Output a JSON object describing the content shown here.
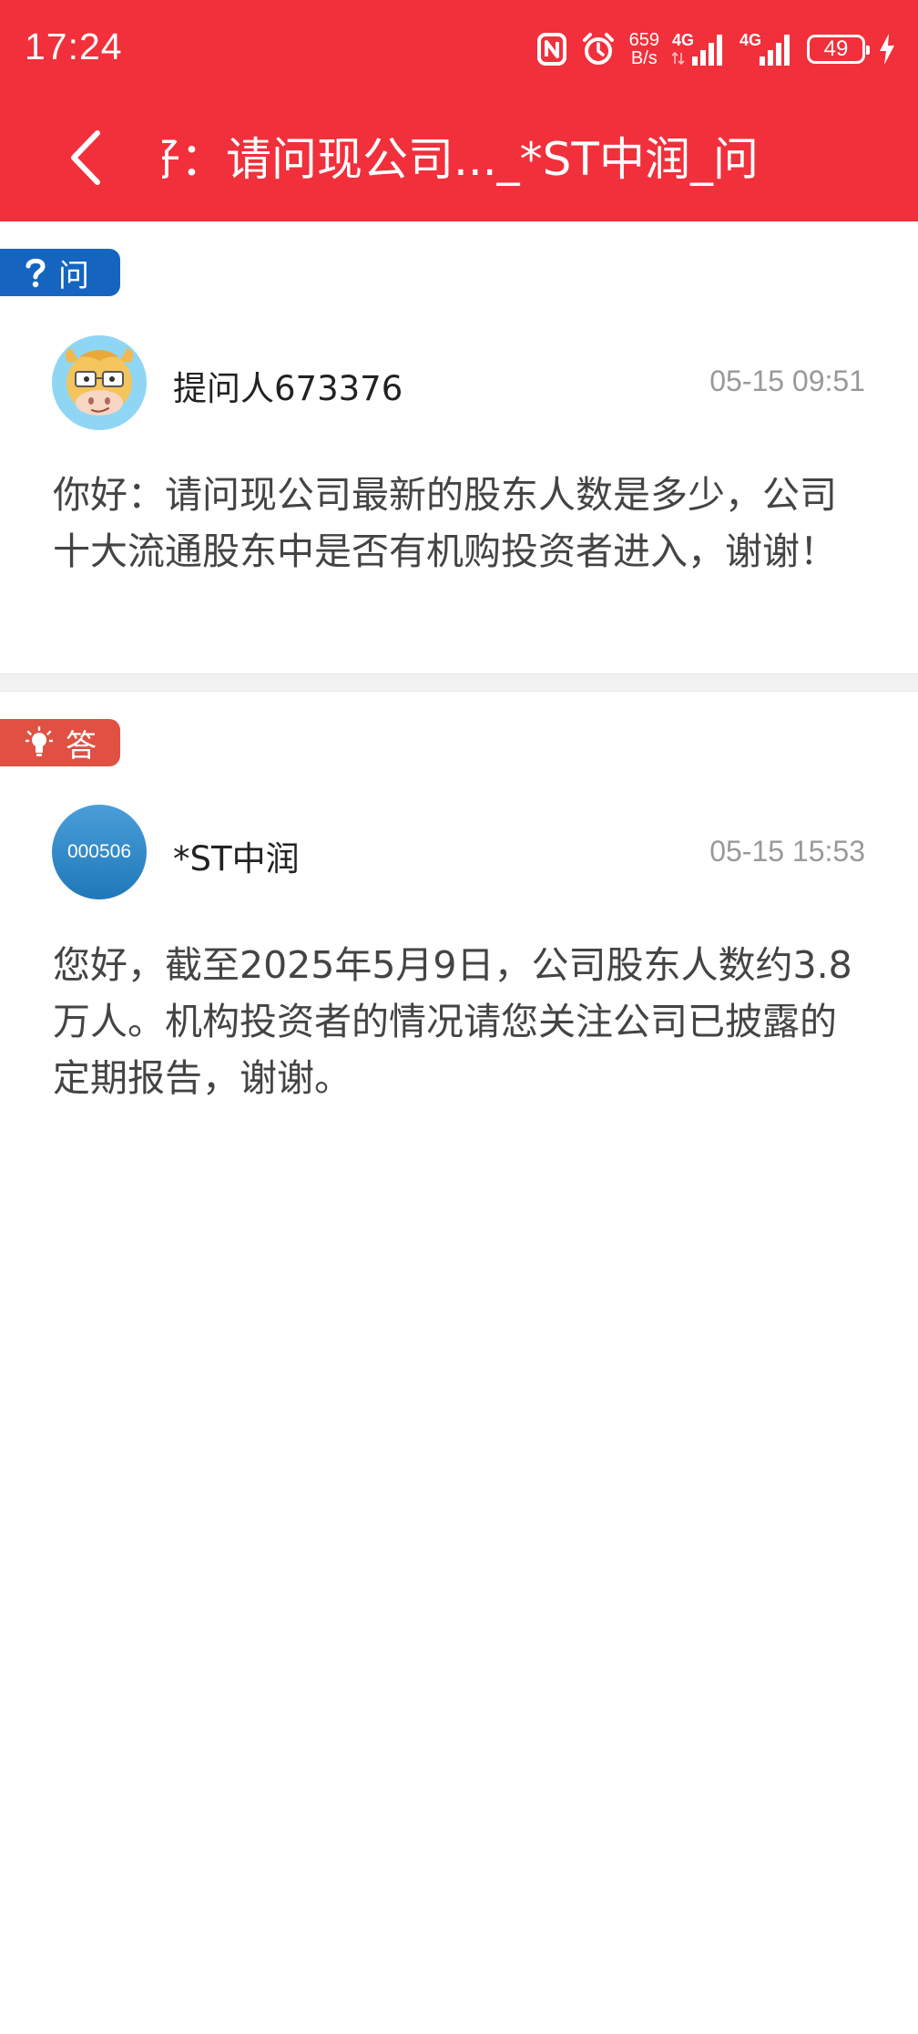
{
  "status_bar": {
    "time": "17:24",
    "net_speed_value": "659",
    "net_speed_unit": "B/s",
    "signal_1_label": "4G",
    "signal_2_label": "4G",
    "battery": "49"
  },
  "titlebar": {
    "title": "好：请问现公司..._*ST中润_问"
  },
  "question": {
    "tag_label": "问",
    "author": "提问人673376",
    "time": "05-15 09:51",
    "content": "你好：请问现公司最新的股东人数是多少，公司十大流通股东中是否有机购投资者进入，谢谢！"
  },
  "answer": {
    "tag_label": "答",
    "avatar_code": "000506",
    "author": "*ST中润",
    "time": "05-15 15:53",
    "content": "您好，截至2025年5月9日，公司股东人数约3.8万人。机构投资者的情况请您关注公司已披露的定期报告，谢谢。"
  },
  "colors": {
    "header": "#f1303b",
    "question_tag": "#1565c0",
    "answer_tag": "#e05043"
  }
}
